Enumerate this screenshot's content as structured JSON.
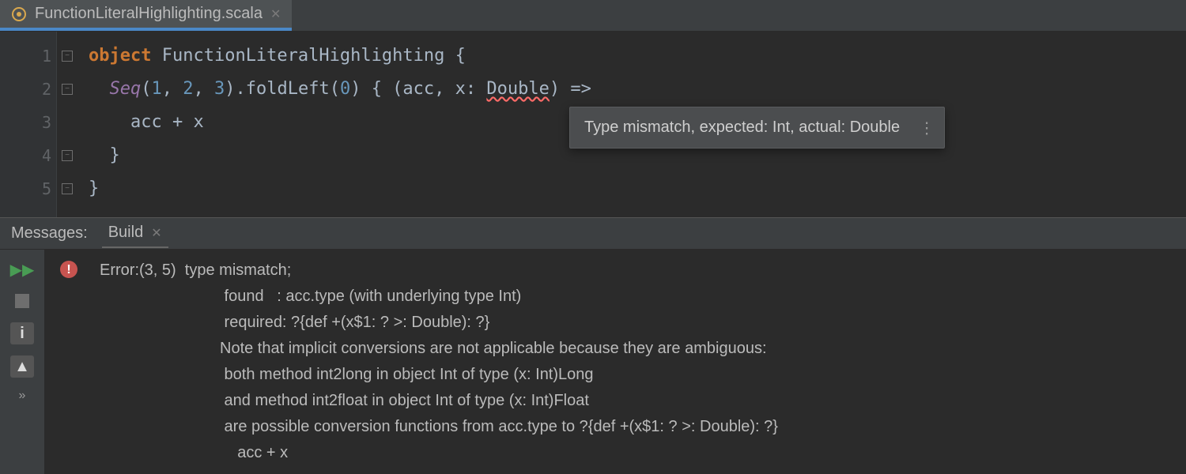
{
  "tab": {
    "filename": "FunctionLiteralHighlighting.scala",
    "icon": "scala-file-icon"
  },
  "code": {
    "lines": [
      "1",
      "2",
      "3",
      "4",
      "5"
    ],
    "l1_kw": "object",
    "l1_ident": " FunctionLiteralHighlighting {",
    "l2_indent": "  ",
    "l2_seq": "Seq",
    "l2_open": "(",
    "l2_n1": "1",
    "l2_c1": ", ",
    "l2_n2": "2",
    "l2_c2": ", ",
    "l2_n3": "3",
    "l2_close": ").foldLeft(",
    "l2_zero": "0",
    "l2_mid": ") { (acc, x: ",
    "l2_type": "Double",
    "l2_end": ") =>",
    "l3": "    acc + x",
    "l4": "  }",
    "l5": "}"
  },
  "tooltip": {
    "text": "Type mismatch, expected: Int, actual: Double"
  },
  "messages": {
    "title": "Messages:",
    "tab_label": "Build"
  },
  "error": {
    "head": "Error:(3, 5)  type mismatch;",
    "line2": " found   : acc.type (with underlying type Int)",
    "line3": " required: ?{def +(x$1: ? >: Double): ?}",
    "line4": "Note that implicit conversions are not applicable because they are ambiguous:",
    "line5": " both method int2long in object Int of type (x: Int)Long",
    "line6": " and method int2float in object Int of type (x: Int)Float",
    "line7": " are possible conversion functions from acc.type to ?{def +(x$1: ? >: Double): ?}",
    "line8": "    acc + x"
  }
}
